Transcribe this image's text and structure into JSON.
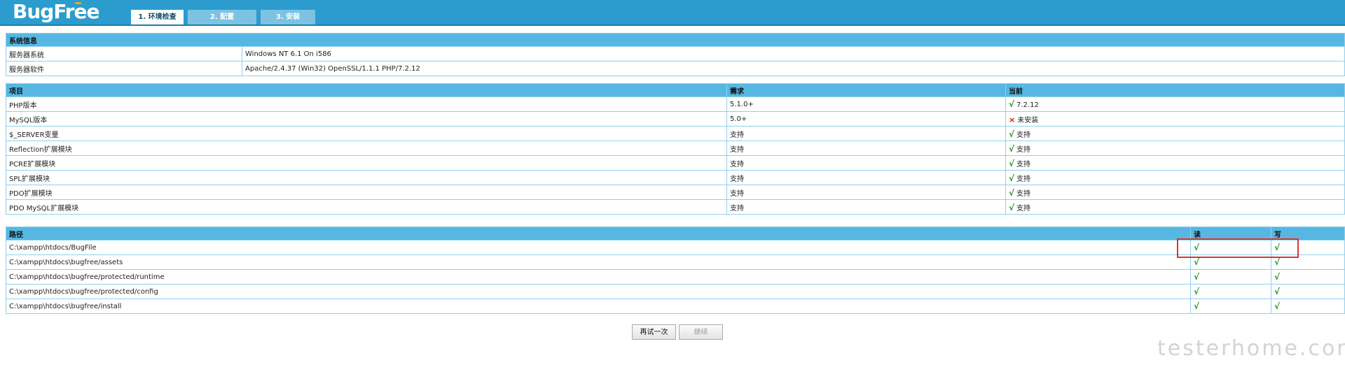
{
  "brand": {
    "logo_text_1": "BugFr",
    "logo_text_2": "e",
    "logo_text_3": "e"
  },
  "tabs": [
    {
      "label": "1. 环境检查",
      "active": true
    },
    {
      "label": "2. 配置",
      "active": false
    },
    {
      "label": "3. 安装",
      "active": false
    }
  ],
  "server_info": {
    "header": "系统信息",
    "rows": [
      {
        "name": "服务器系统",
        "value": "Windows NT 6.1 On i586"
      },
      {
        "name": "服务器软件",
        "value": "Apache/2.4.37 (Win32) OpenSSL/1.1.1 PHP/7.2.12"
      }
    ]
  },
  "requirements": {
    "headers": {
      "item": "项目",
      "required": "需求",
      "current": "当前"
    },
    "rows": [
      {
        "item": "PHP版本",
        "required": "5.1.0+",
        "status": "ok",
        "current": "7.2.12"
      },
      {
        "item": "MySQL版本",
        "required": "5.0+",
        "status": "bad",
        "current": "未安装"
      },
      {
        "item": "$_SERVER变量",
        "required": "支持",
        "status": "ok",
        "current": "支持"
      },
      {
        "item": "Reflection扩展模块",
        "required": "支持",
        "status": "ok",
        "current": "支持"
      },
      {
        "item": "PCRE扩展模块",
        "required": "支持",
        "status": "ok",
        "current": "支持"
      },
      {
        "item": "SPL扩展模块",
        "required": "支持",
        "status": "ok",
        "current": "支持"
      },
      {
        "item": "PDO扩展模块",
        "required": "支持",
        "status": "ok",
        "current": "支持"
      },
      {
        "item": "PDO MySQL扩展模块",
        "required": "支持",
        "status": "ok",
        "current": "支持"
      }
    ]
  },
  "paths": {
    "headers": {
      "path": "路径",
      "read": "读",
      "write": "写"
    },
    "rows": [
      {
        "path": "C:\\xampp\\htdocs/BugFile",
        "read": "√",
        "write": "√"
      },
      {
        "path": "C:\\xampp\\htdocs\\bugfree/assets",
        "read": "√",
        "write": "√"
      },
      {
        "path": "C:\\xampp\\htdocs\\bugfree/protected/runtime",
        "read": "√",
        "write": "√"
      },
      {
        "path": "C:\\xampp\\htdocs\\bugfree/protected/config",
        "read": "√",
        "write": "√"
      },
      {
        "path": "C:\\xampp\\htdocs\\bugfree/install",
        "read": "√",
        "write": "√"
      }
    ]
  },
  "icons": {
    "ok": "√",
    "bad": "×"
  },
  "buttons": {
    "retry": "再试一次",
    "continue": "继续"
  },
  "watermark": "testerhome.com",
  "colors": {
    "header_bar": "#2b9ccd",
    "table_header": "#56b8e2",
    "ok": "#1c8d1c",
    "bad": "#d01c1c",
    "highlight": "#e0312f"
  }
}
